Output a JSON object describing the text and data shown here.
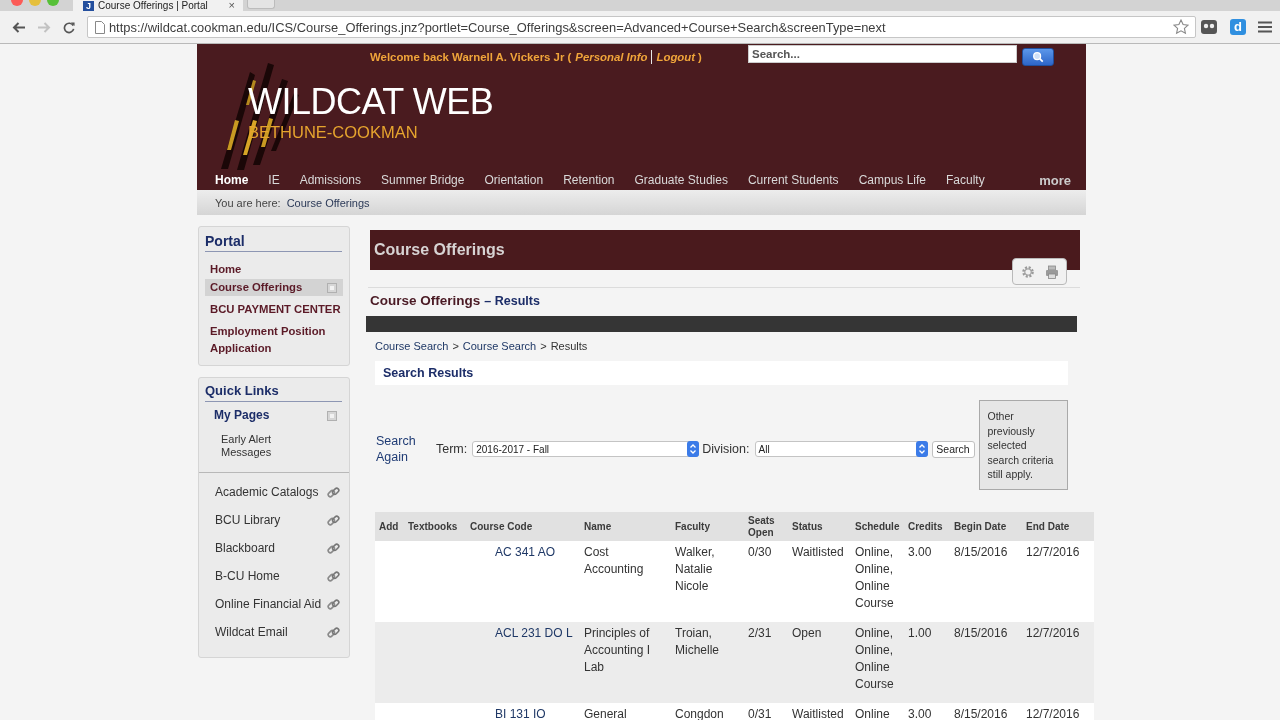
{
  "browser": {
    "tab": {
      "favicon": "J",
      "title": "Course Offerings | Portal",
      "close": "×"
    },
    "nav_buttons": [
      {
        "kind": "back",
        "disabled": false
      },
      {
        "kind": "forward",
        "disabled": true
      },
      {
        "kind": "reload",
        "disabled": false
      }
    ],
    "url": "https://wildcat.cookman.edu/ICS/Course_Offerings.jnz?portlet=Course_Offerings&screen=Advanced+Course+Search&screenType=next",
    "extension_badge": "d"
  },
  "header": {
    "welcome": "Welcome back Warnell A. Vickers Jr (",
    "links": [
      "Personal Info",
      "Logout"
    ],
    "welcome_end": ")",
    "search": {
      "placeholder": "Search..."
    },
    "logo": {
      "title": "WILDCAT WEB",
      "subtitle": "BETHUNE-COOKMAN"
    },
    "nav": [
      {
        "label": "Home",
        "selected": true
      },
      {
        "label": "IE",
        "selected": false
      },
      {
        "label": "Admissions",
        "selected": false
      },
      {
        "label": "Summer Bridge",
        "selected": false
      },
      {
        "label": "Orientation",
        "selected": false
      },
      {
        "label": "Retention",
        "selected": false
      },
      {
        "label": "Graduate Studies",
        "selected": false
      },
      {
        "label": "Current Students",
        "selected": false
      },
      {
        "label": "Campus Life",
        "selected": false
      },
      {
        "label": "Faculty",
        "selected": false
      }
    ],
    "more": "more"
  },
  "breadcrumb": {
    "label": "You are here:",
    "current": "Course Offerings"
  },
  "sidebar": {
    "portal": {
      "title": "Portal",
      "items": [
        {
          "label": "Home",
          "selected": false,
          "toggle": false
        },
        {
          "label": "Course Offerings",
          "selected": true,
          "toggle": true
        },
        {
          "label": "BCU PAYMENT CENTER",
          "selected": false,
          "toggle": false
        },
        {
          "label": "Employment Position Application",
          "selected": false,
          "toggle": false
        }
      ]
    },
    "quick_links": {
      "title": "Quick Links",
      "pages": {
        "label": "My Pages",
        "toggle": true,
        "children": [
          {
            "label": "Early Alert Messages"
          }
        ]
      },
      "links": [
        "Academic Catalogs",
        "BCU Library",
        "Blackboard",
        "B-CU Home",
        "Online Financial Aid",
        "Wildcat Email"
      ]
    }
  },
  "main": {
    "banner": "Course Offerings",
    "heading": {
      "title": "Course Offerings",
      "sub": "– Results"
    },
    "crumbs": [
      {
        "kind": "link",
        "text": "Course Search"
      },
      {
        "kind": "sep",
        "text": ">"
      },
      {
        "kind": "link",
        "text": "Course Search"
      },
      {
        "kind": "sep",
        "text": ">"
      },
      {
        "kind": "current",
        "text": "Results"
      }
    ],
    "section_title": "Search Results",
    "search_form": {
      "again": "Search Again",
      "term": {
        "label": "Term:",
        "value": "2016-2017 - Fall"
      },
      "division": {
        "label": "Division:",
        "value": "All"
      },
      "button": "Search",
      "note": "Other previously selected search criteria still apply."
    },
    "table": {
      "columns": [
        "Add",
        "Textbooks",
        "Course Code",
        "Name",
        "Faculty",
        "Seats Open",
        "Status",
        "Schedule",
        "Credits",
        "Begin Date",
        "End Date"
      ],
      "rows": [
        {
          "code": "AC 341 AO",
          "name": "Cost Accounting",
          "faculty": "Walker, Natalie Nicole",
          "seats": "0/30",
          "status": "Waitlisted",
          "schedule": "Online, Online, Online Course",
          "credits": "3.00",
          "begin": "8/15/2016",
          "end": "12/7/2016"
        },
        {
          "code": "ACL 231 DO L",
          "name": "Principles of Accounting I Lab",
          "faculty": "Troian, Michelle",
          "seats": "2/31",
          "status": "Open",
          "schedule": "Online, Online, Online Course",
          "credits": "1.00",
          "begin": "8/15/2016",
          "end": "12/7/2016"
        },
        {
          "code": "BI 131 IO",
          "name": "General",
          "faculty": "Congdon",
          "seats": "0/31",
          "status": "Waitlisted",
          "schedule": "Online",
          "credits": "3.00",
          "begin": "8/15/2016",
          "end": "12/7/2016"
        }
      ]
    }
  }
}
